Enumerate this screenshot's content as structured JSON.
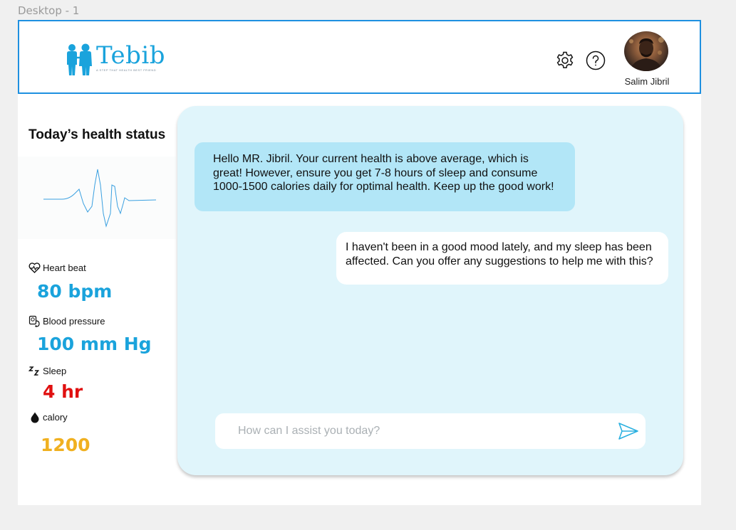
{
  "frame": {
    "label": "Desktop - 1"
  },
  "header": {
    "logo": {
      "name": "Tebib",
      "tagline": "A STEP THAT HEALTH BEST FRIEND",
      "color": "#1aa3dc"
    },
    "icons": [
      "gear-icon",
      "help-icon"
    ],
    "user": {
      "name": "Salim Jibril"
    }
  },
  "sidebar": {
    "title": "Today’s health status",
    "stats": [
      {
        "icon": "heart-pulse-icon",
        "label": "Heart beat",
        "value": "80 bpm",
        "color": "#1aa3dc"
      },
      {
        "icon": "blood-pressure-icon",
        "label": "Blood pressure",
        "value": "100 mm Hg",
        "color": "#1aa3dc"
      },
      {
        "icon": "sleep-icon",
        "label": "Sleep",
        "value": "4 hr",
        "color": "#e01010"
      },
      {
        "icon": "drop-icon",
        "label": "calory",
        "value": "1200",
        "color": "#f0b020"
      }
    ]
  },
  "chat": {
    "messages": [
      {
        "from": "assistant",
        "text": "Hello MR. Jibril. Your current health is above average, which is great! However, ensure you get 7-8 hours of sleep and consume 1000-1500 calories daily for optimal health. Keep up the good work!"
      },
      {
        "from": "user",
        "text": "I haven't been in a good mood lately, and my sleep has been affected. Can you offer any suggestions to help me with this?"
      }
    ],
    "input": {
      "placeholder": "How can I assist you today?",
      "value": ""
    }
  }
}
